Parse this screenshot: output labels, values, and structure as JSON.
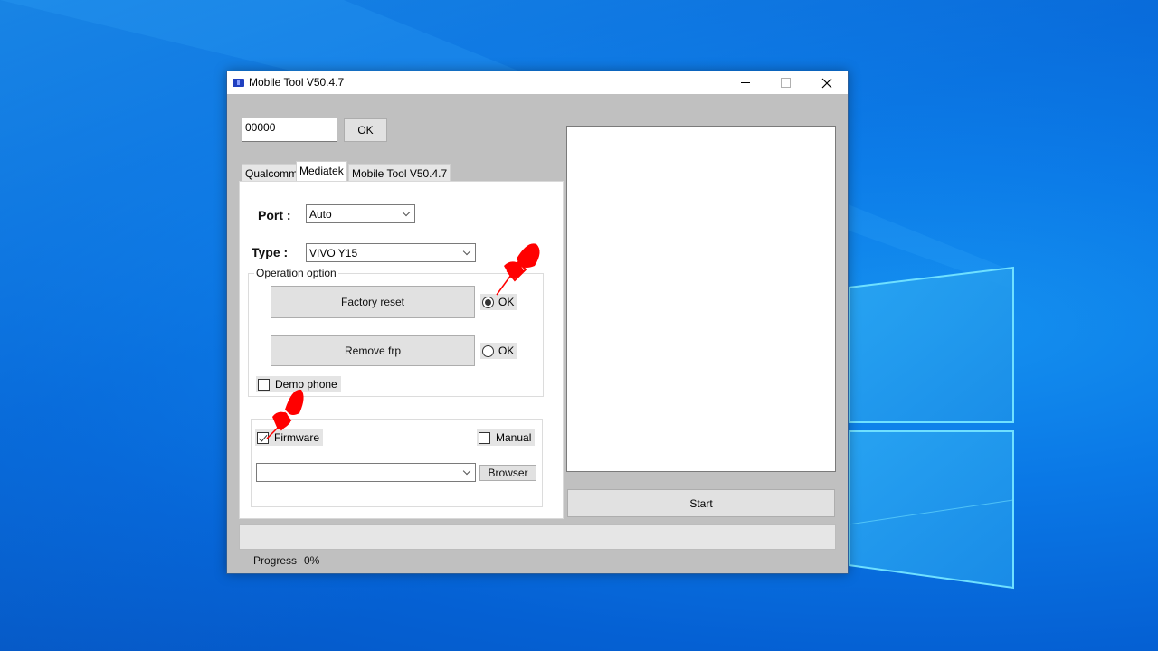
{
  "window": {
    "title": "Mobile Tool V50.4.7",
    "controls": {
      "minimize": "minimize",
      "maximize": "maximize",
      "close": "close"
    }
  },
  "code": {
    "value": "00000",
    "ok_label": "OK"
  },
  "tabs": [
    {
      "label": "Qualcomm",
      "active": false
    },
    {
      "label": "Mediatek",
      "active": true
    },
    {
      "label": "Mobile Tool V50.4.7",
      "active": false
    }
  ],
  "mediatek": {
    "port_label": "Port :",
    "port_value": "Auto",
    "type_label": "Type :",
    "type_value": "VIVO Y15",
    "operation_group_title": "Operation option",
    "factory_reset_label": "Factory reset",
    "factory_reset_radio": {
      "label": "OK",
      "checked": true
    },
    "remove_frp_label": "Remove frp",
    "remove_frp_radio": {
      "label": "OK",
      "checked": false
    },
    "demo_phone": {
      "label": "Demo phone",
      "checked": false
    },
    "firmware": {
      "label": "Firmware",
      "checked": true
    },
    "manual": {
      "label": "Manual",
      "checked": false
    },
    "firmware_path_value": "",
    "browser_label": "Browser"
  },
  "log_text": "",
  "start_label": "Start",
  "progress": {
    "label": "Progress",
    "value_text": "0%",
    "fraction": 0
  },
  "annotations": {
    "pin_color": "#ff0000",
    "count": 2
  }
}
